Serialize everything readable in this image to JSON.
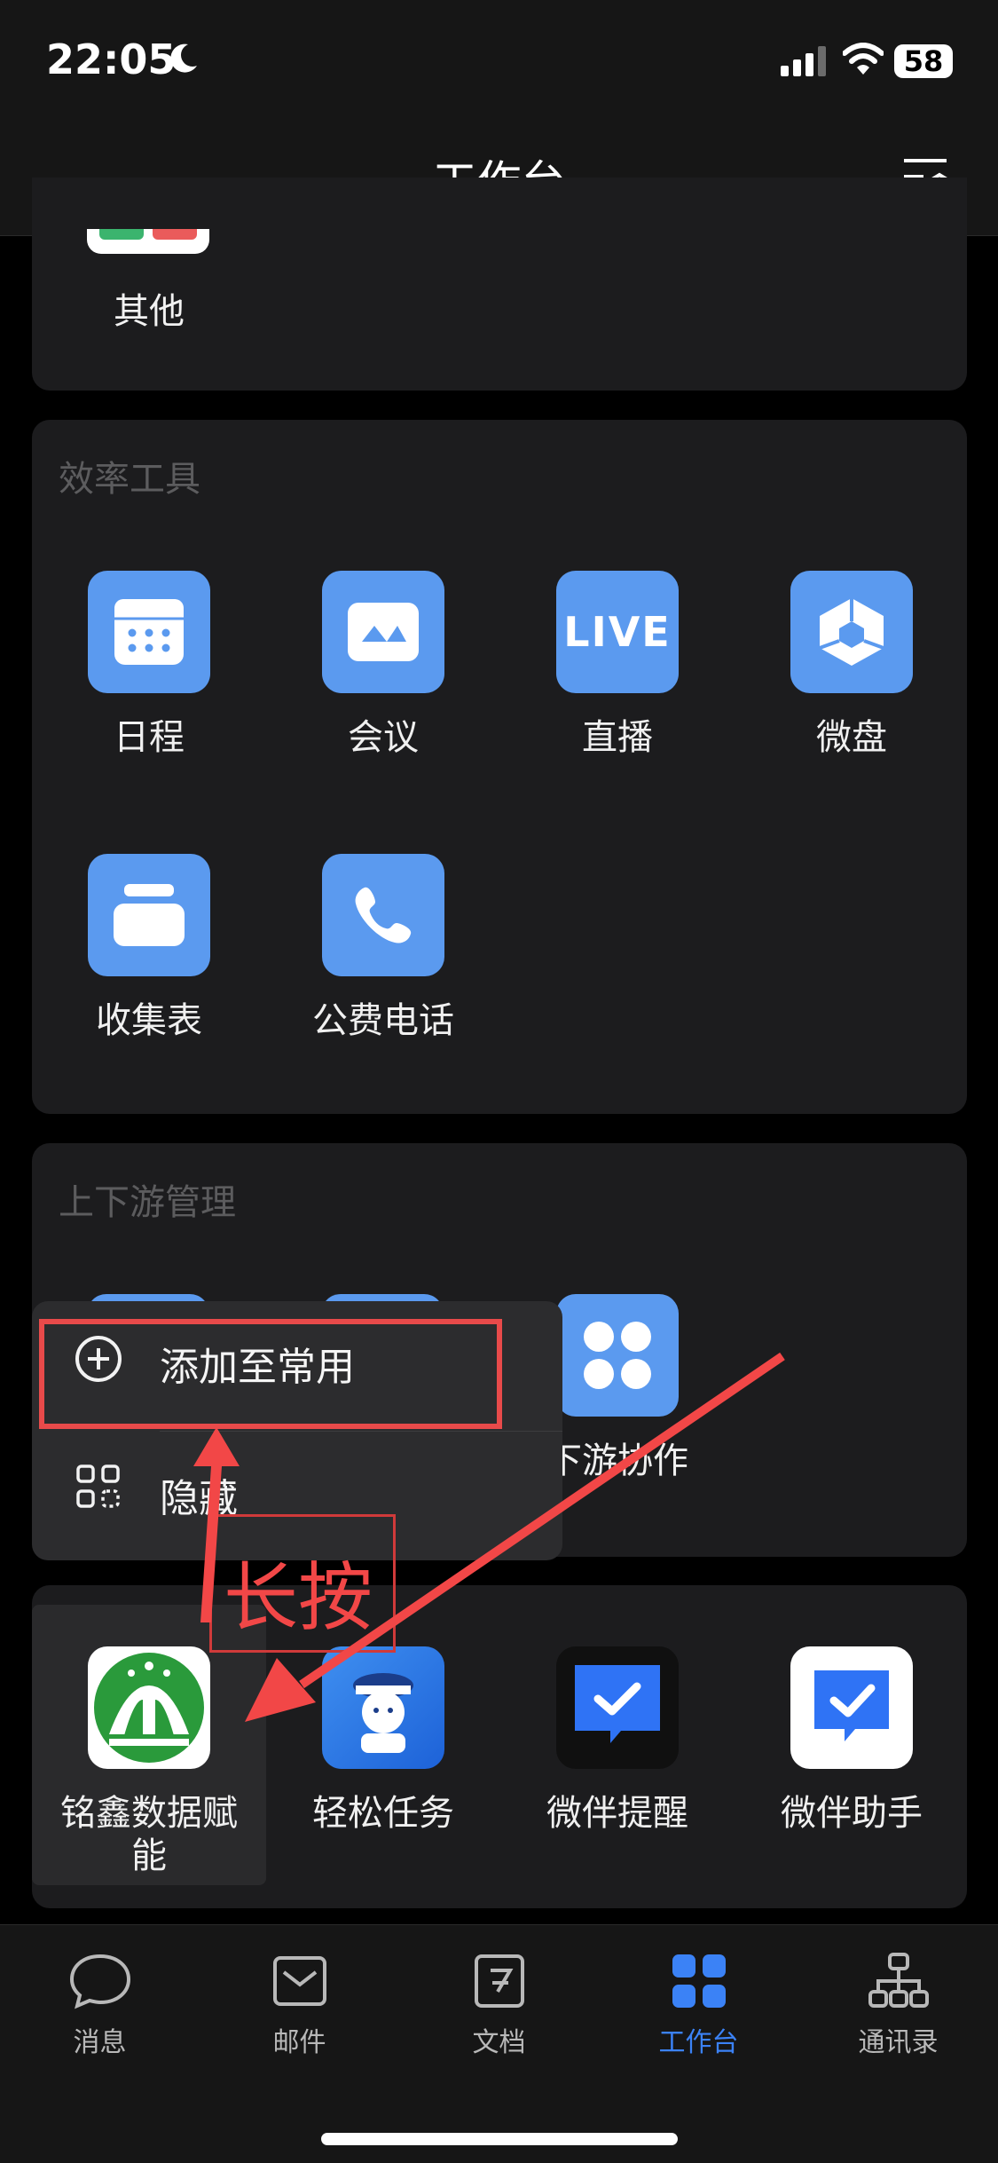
{
  "status": {
    "time": "22:05",
    "battery": "58"
  },
  "nav": {
    "title": "工作台"
  },
  "sections": {
    "other": {
      "label": "其他"
    },
    "efficiency": {
      "title": "效率工具",
      "apps": [
        {
          "label": "日程"
        },
        {
          "label": "会议"
        },
        {
          "label": "直播",
          "tile_text": "LIVE"
        },
        {
          "label": "微盘"
        },
        {
          "label": "收集表"
        },
        {
          "label": "公费电话"
        }
      ]
    },
    "upstream": {
      "title": "上下游管理",
      "apps": [
        {
          "label": "下游协作"
        }
      ]
    },
    "custom": {
      "apps": [
        {
          "label": "铭鑫数据赋能"
        },
        {
          "label": "轻松任务"
        },
        {
          "label": "微伴提醒"
        },
        {
          "label": "微伴助手"
        }
      ]
    }
  },
  "popup": {
    "items": [
      {
        "label": "添加至常用",
        "icon": "plus-circle-icon"
      },
      {
        "label": "隐藏",
        "icon": "hide-grid-icon"
      }
    ]
  },
  "annotation": {
    "text": "长按",
    "color": "#f24747"
  },
  "tabbar": {
    "active_color": "#3b82f6",
    "tabs": [
      {
        "label": "消息",
        "icon": "chat-bubble-icon"
      },
      {
        "label": "邮件",
        "icon": "mail-icon"
      },
      {
        "label": "文档",
        "icon": "document-icon"
      },
      {
        "label": "工作台",
        "icon": "workbench-grid-icon",
        "active": true
      },
      {
        "label": "通讯录",
        "icon": "contacts-icon"
      }
    ]
  }
}
